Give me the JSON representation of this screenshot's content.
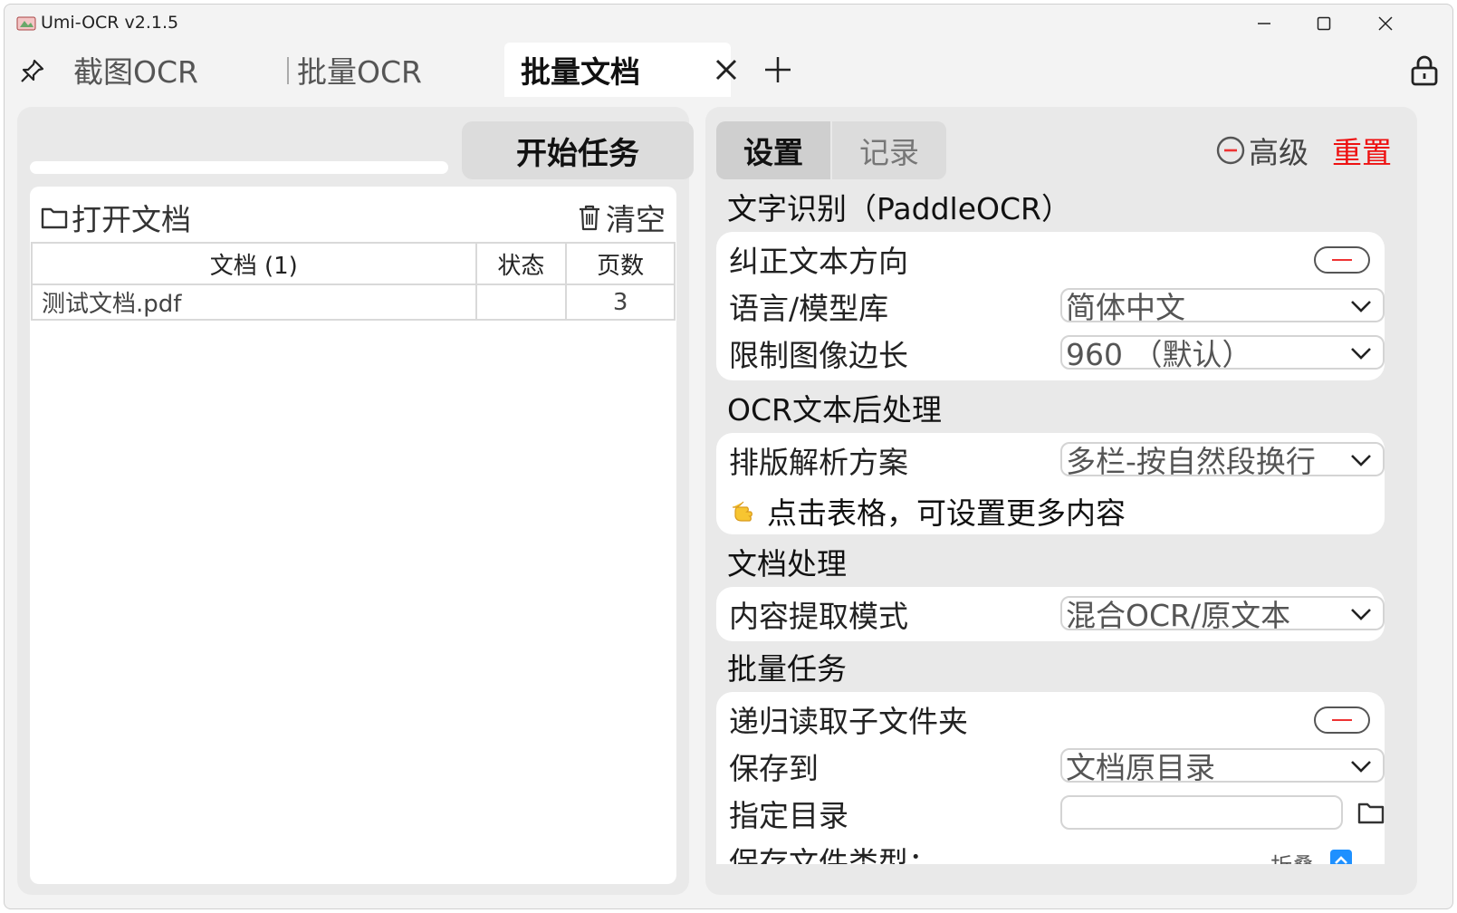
{
  "window": {
    "title": "Umi-OCR v2.1.5"
  },
  "tabs": [
    {
      "label": "截图OCR"
    },
    {
      "label": "批量OCR"
    },
    {
      "label": "批量文档"
    }
  ],
  "left": {
    "start_label": "开始任务",
    "open_label": "打开文档",
    "clear_label": "清空",
    "columns": [
      "文档 (1)",
      "状态",
      "页数"
    ],
    "rows": [
      {
        "name": "测试文档.pdf",
        "status": "",
        "pages": "3"
      }
    ]
  },
  "right": {
    "tab_settings": "设置",
    "tab_records": "记录",
    "advanced_label": "高级",
    "reset_label": "重置",
    "sections": {
      "ocr_title": "文字识别（PaddleOCR）",
      "post_title": "OCR文本后处理",
      "doc_title": "文档处理",
      "batch_title": "批量任务"
    },
    "ocr": {
      "direction_label": "纠正文本方向",
      "language_label": "语言/模型库",
      "language_value": "简体中文",
      "limit_label": "限制图像边长",
      "limit_value": "960 （默认）"
    },
    "post": {
      "layout_label": "排版解析方案",
      "layout_value": "多栏-按自然段换行",
      "hint": "点击表格，可设置更多内容"
    },
    "doc": {
      "extract_label": "内容提取模式",
      "extract_value": "混合OCR/原文本"
    },
    "batch": {
      "recurse_label": "递归读取子文件夹",
      "save_label": "保存到",
      "save_value": "文档原目录",
      "dir_label": "指定目录",
      "dir_value": "",
      "filetype_label": "保存文件类型：",
      "fold_label": "折叠"
    }
  },
  "colors": {
    "accent": "#1e90ff",
    "reset": "#e11111",
    "toggle_off_mark": "#e33333"
  }
}
